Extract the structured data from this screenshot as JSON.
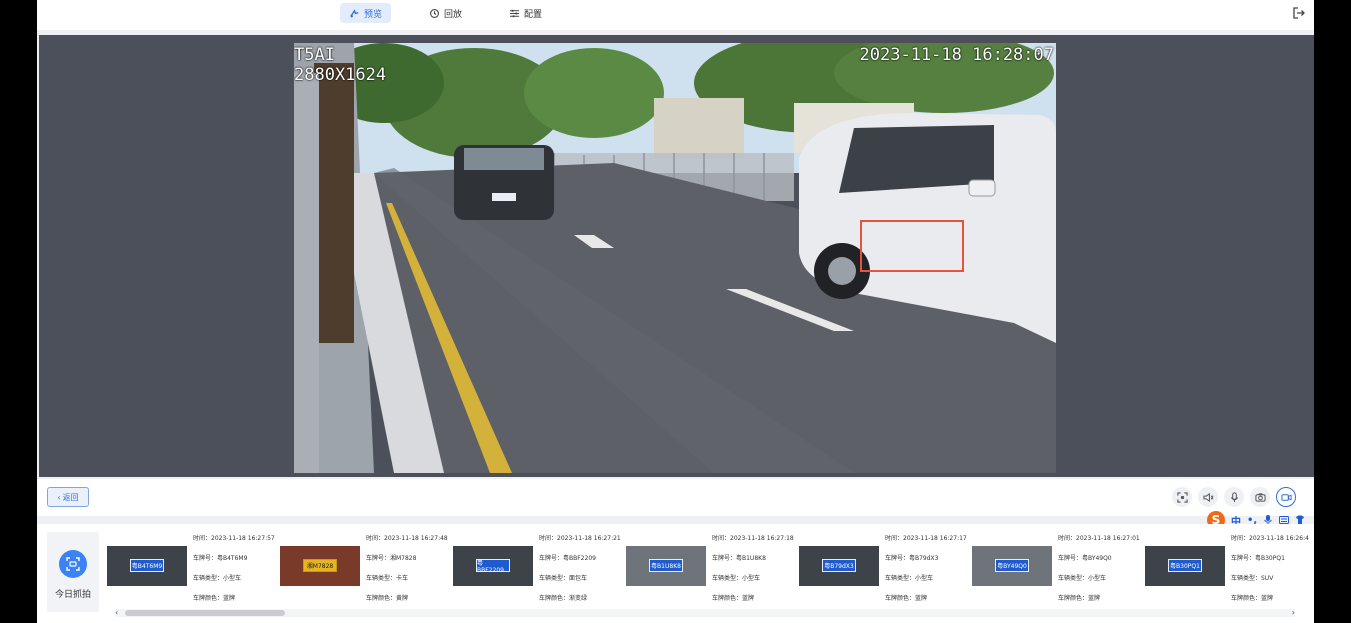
{
  "topbar": {
    "tabs": [
      {
        "label": "预览",
        "icon": "preview-icon",
        "active": true
      },
      {
        "label": "回放",
        "icon": "playback-icon",
        "active": false
      },
      {
        "label": "配置",
        "icon": "config-icon",
        "active": false
      }
    ],
    "exit_icon": "logout-icon"
  },
  "video": {
    "osd_name": "T5AI",
    "osd_resolution": "2880X1624",
    "osd_timestamp": "2023-11-18 16:28:07"
  },
  "controls": {
    "back_label": "返回",
    "icons": [
      "screenshot-icon",
      "volume-icon",
      "microphone-icon",
      "camera-icon",
      "record-icon"
    ]
  },
  "ime": {
    "logo": "S",
    "lang": "中",
    "punct": "•,"
  },
  "captures": {
    "today_label": "今日抓拍",
    "items": [
      {
        "time": "时间：2023-11-18 16:27:57",
        "plate": "车牌号：粤B4T6M9",
        "type": "车辆类型：小型车",
        "color": "车牌颜色：蓝牌",
        "plate_text": "粤B4T6M9",
        "plate_color": "blue"
      },
      {
        "time": "时间：2023-11-18 16:27:48",
        "plate": "车牌号：湘M7828",
        "type": "车辆类型：卡车",
        "color": "车牌颜色：黄牌",
        "plate_text": "湘M7828",
        "plate_color": "yellow"
      },
      {
        "time": "时间：2023-11-18 16:27:21",
        "plate": "车牌号：粤BBF2209",
        "type": "车辆类型：面包车",
        "color": "车牌颜色：渐变绿",
        "plate_text": "粤BBF2209",
        "plate_color": "blue"
      },
      {
        "time": "时间：2023-11-18 16:27:18",
        "plate": "车牌号：粤B1U8K8",
        "type": "车辆类型：小型车",
        "color": "车牌颜色：蓝牌",
        "plate_text": "粤B1U8K8",
        "plate_color": "blue"
      },
      {
        "time": "时间：2023-11-18 16:27:17",
        "plate": "车牌号：粤B79dX3",
        "type": "车辆类型：小型车",
        "color": "车牌颜色：蓝牌",
        "plate_text": "粤B79dX3",
        "plate_color": "blue"
      },
      {
        "time": "时间：2023-11-18 16:27:01",
        "plate": "车牌号：粤BY49Q0",
        "type": "车辆类型：小型车",
        "color": "车牌颜色：蓝牌",
        "plate_text": "粤BY49Q0",
        "plate_color": "blue"
      },
      {
        "time": "时间：2023-11-18 16:26:4",
        "plate": "车牌号：粤B30PQ1",
        "type": "车辆类型：SUV",
        "color": "车牌颜色：蓝牌",
        "plate_text": "粤B30PQ1",
        "plate_color": "blue"
      }
    ]
  },
  "colors": {
    "accent": "#2f6fd6",
    "viewer_bg": "#4b505a",
    "highlight": "#e6553b"
  }
}
